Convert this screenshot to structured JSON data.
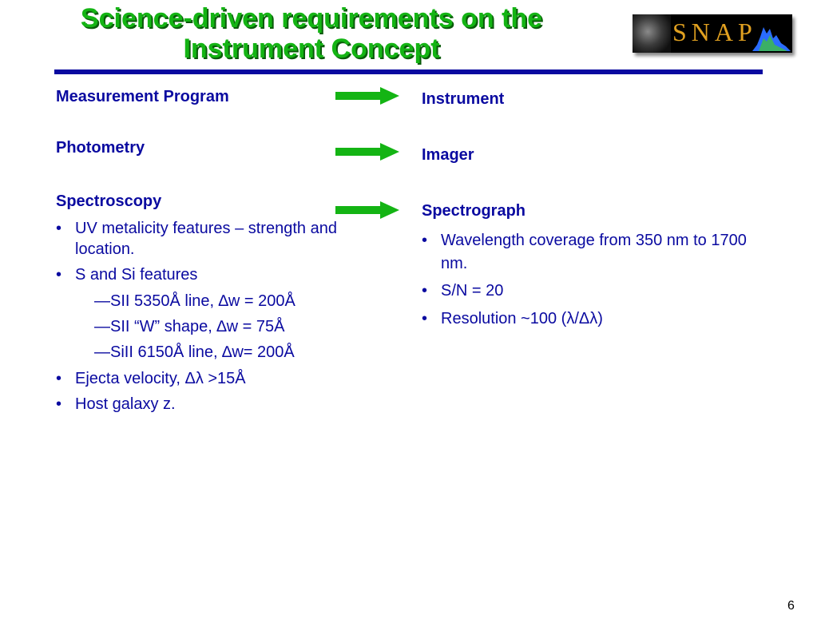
{
  "slide": {
    "title_line1": "Science-driven requirements on the",
    "title_line2": "Instrument Concept",
    "page_number": "6"
  },
  "logo": {
    "text": "SNAP",
    "icon": "snap-logo-icon"
  },
  "left": {
    "measurement_heading": "Measurement Program",
    "photometry_heading": "Photometry",
    "spectroscopy_heading": "Spectroscopy",
    "bullets": [
      "UV metalicity features – strength and location.",
      "S and Si features",
      "Ejecta velocity, Δλ  >15Å",
      "Host galaxy z."
    ],
    "sub_items": [
      "—SII 5350Å line, ∆w = 200Å",
      "—SII “W” shape, ∆w = 75Å",
      "—SiII 6150Å line, ∆w= 200Å"
    ]
  },
  "right": {
    "instrument_heading": "Instrument",
    "imager_heading": "Imager",
    "spectrograph_heading": "Spectrograph",
    "bullets": [
      "Wavelength coverage from 350 nm to 1700 nm.",
      "S/N = 20",
      "Resolution ~100 (λ/Δλ)"
    ]
  },
  "colors": {
    "title_green": "#14b414",
    "body_blue": "#0a0aa0",
    "arrow_green": "#14b414"
  }
}
